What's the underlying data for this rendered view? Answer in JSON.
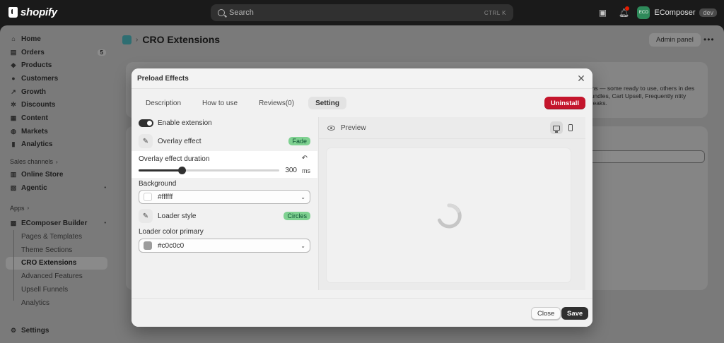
{
  "topbar": {
    "logo": "shopify",
    "search_placeholder": "Search",
    "kbd": "CTRL  K",
    "store_name": "EComposer",
    "store_initials": "ECO",
    "env_badge": "dev"
  },
  "sidebar": {
    "items": [
      {
        "label": "Home",
        "icon": "home-icon"
      },
      {
        "label": "Orders",
        "icon": "orders-icon",
        "count": "5"
      },
      {
        "label": "Products",
        "icon": "tag-icon"
      },
      {
        "label": "Customers",
        "icon": "person-icon"
      },
      {
        "label": "Growth",
        "icon": "growth-icon"
      },
      {
        "label": "Discounts",
        "icon": "discount-icon"
      },
      {
        "label": "Content",
        "icon": "content-icon"
      },
      {
        "label": "Markets",
        "icon": "globe-icon"
      },
      {
        "label": "Analytics",
        "icon": "chart-icon"
      }
    ],
    "sales_channels_label": "Sales channels",
    "channels": [
      {
        "label": "Online Store",
        "icon": "store-icon"
      },
      {
        "label": "Agentic",
        "icon": "agentic-icon"
      }
    ],
    "apps_label": "Apps",
    "app_name": "EComposer Builder",
    "app_subitems": [
      "Pages & Templates",
      "Theme Sections",
      "CRO Extensions",
      "Advanced Features",
      "Upsell Funnels",
      "Analytics"
    ],
    "settings_label": "Settings"
  },
  "page": {
    "title": "CRO Extensions",
    "admin_panel_label": "Admin panel",
    "bg_text": "ions — some ready to use, others in des Bundles, Cart Upsell, Frequently ntity Breaks."
  },
  "modal": {
    "title": "Preload Effects",
    "tabs": [
      "Description",
      "How to use",
      "Reviews(0)",
      "Setting"
    ],
    "active_tab": "Setting",
    "uninstall_label": "Uninstall",
    "enable_label": "Enable extension",
    "overlay_effect_label": "Overlay effect",
    "overlay_effect_value": "Fade",
    "duration_label": "Overlay effect duration",
    "duration_value": "300",
    "duration_unit": "ms",
    "duration_fraction": 0.31,
    "background_label": "Background",
    "background_value": "#ffffff",
    "loader_style_label": "Loader style",
    "loader_style_value": "Circles",
    "loader_color_label": "Loader color primary",
    "loader_color_value": "#c0c0c0",
    "preview_label": "Preview",
    "close_label": "Close",
    "save_label": "Save"
  },
  "colors": {
    "uninstall": "#c4152c",
    "badge_green": "#7fd191",
    "primary_dark": "#303030"
  }
}
